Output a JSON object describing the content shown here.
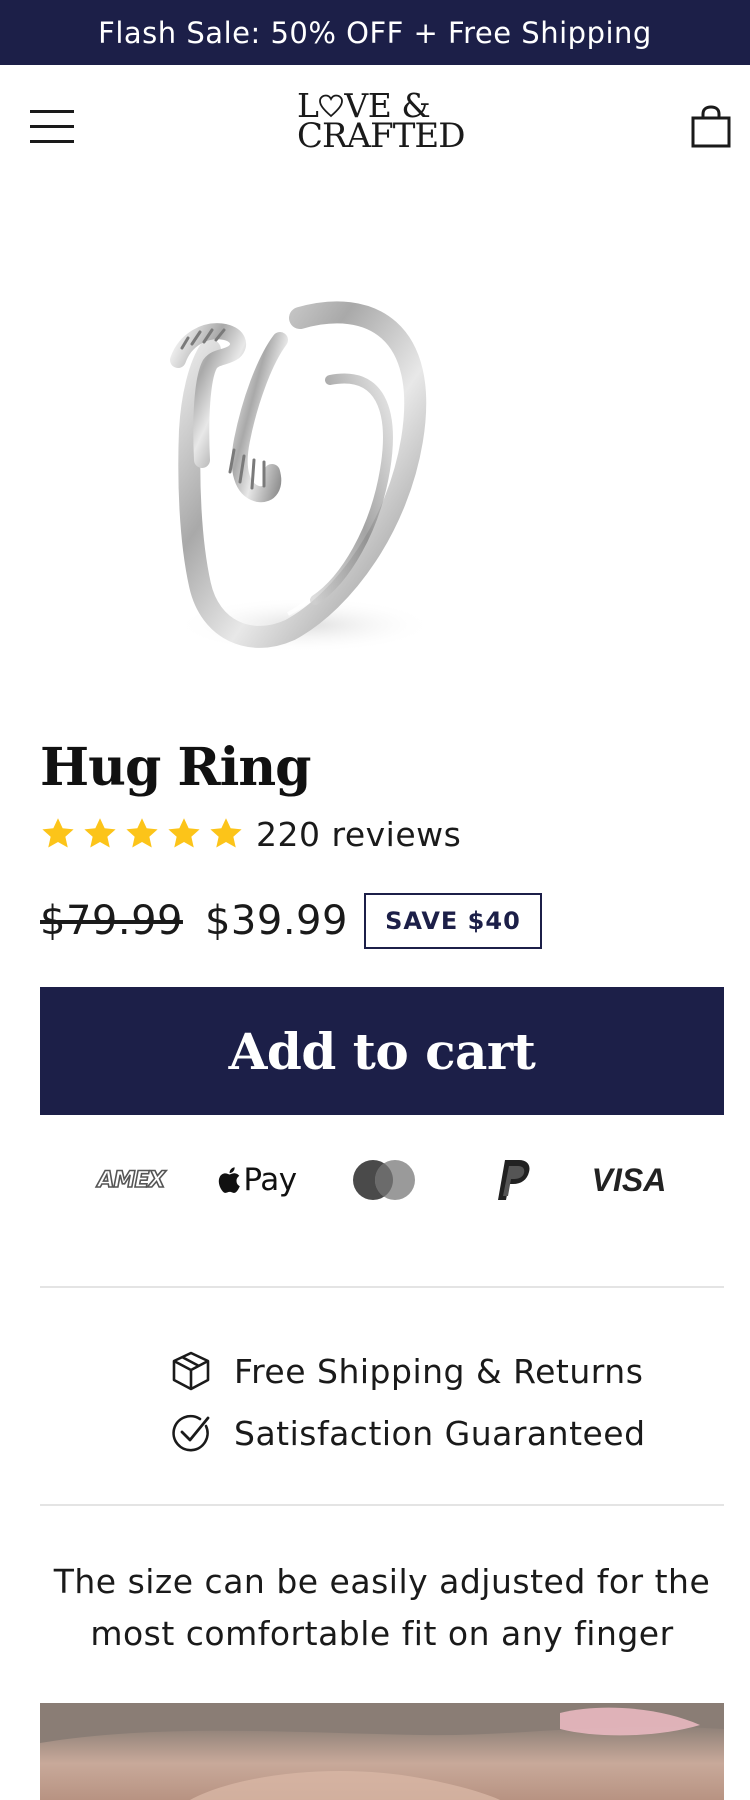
{
  "announcement": {
    "text": "Flash Sale: 50% OFF + Free Shipping"
  },
  "header": {
    "logo_line1_a": "L",
    "logo_line1_b": "VE &",
    "logo_line2": "CRAFTED",
    "icons": [
      "menu-icon",
      "cart-icon"
    ]
  },
  "product": {
    "title": "Hug Ring",
    "rating": 5,
    "reviews": "220 reviews",
    "old_price": "$79.99",
    "price": "$39.99",
    "save_badge": "SAVE $40",
    "add_to_cart": "Add to cart",
    "rating_color": "#fcc419"
  },
  "payments": {
    "amex": "AMEX",
    "applepay": "Pay",
    "visa": "VISA",
    "icons": [
      "amex-icon",
      "apple-pay-icon",
      "mastercard-icon",
      "paypal-icon",
      "visa-icon"
    ]
  },
  "features": [
    {
      "icon": "box-icon",
      "label": "Free Shipping & Returns"
    },
    {
      "icon": "check-circle-icon",
      "label": "Satisfaction Guaranteed"
    }
  ],
  "description": "The size can be easily adjusted for the most comfortable fit on any finger",
  "colors": {
    "brand": "#1c1f48",
    "star": "#fcc419",
    "text": "#1a1a1a",
    "divider": "#e4e4e4"
  }
}
